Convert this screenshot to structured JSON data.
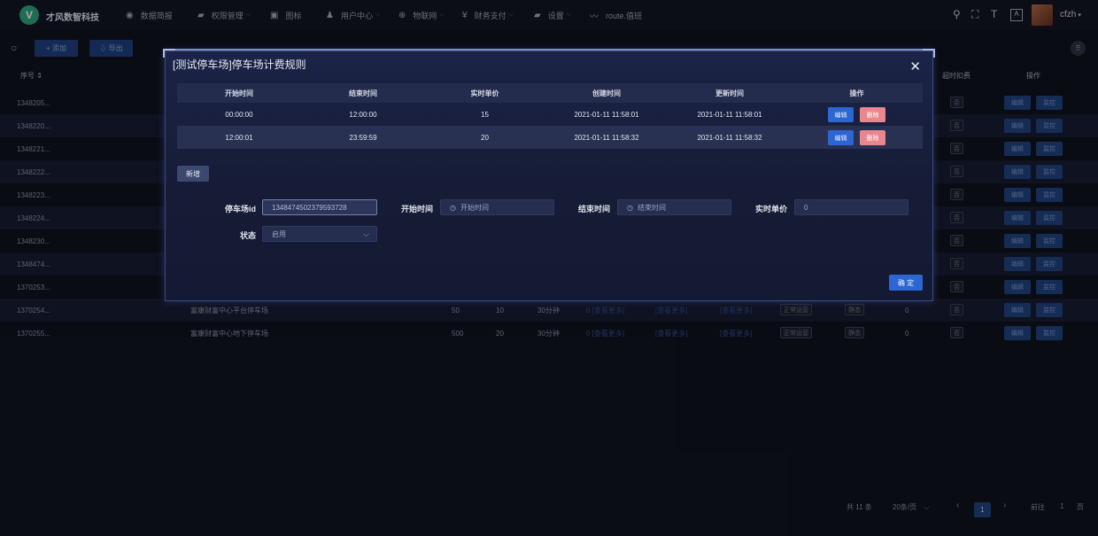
{
  "brand": {
    "logo_letter": "V",
    "name": "才风数智科技"
  },
  "nav": [
    {
      "icon": "dashboard-icon",
      "label": "数据简报",
      "dropdown": false
    },
    {
      "icon": "lock-icon",
      "label": "权限管理",
      "dropdown": true
    },
    {
      "icon": "icon-icon",
      "label": "图标",
      "dropdown": false
    },
    {
      "icon": "user-icon",
      "label": "用户中心",
      "dropdown": true
    },
    {
      "icon": "iot-icon",
      "label": "物联网",
      "dropdown": true
    },
    {
      "icon": "yen-icon",
      "label": "财务支付",
      "dropdown": true
    },
    {
      "icon": "lock-icon",
      "label": "设置",
      "dropdown": true
    },
    {
      "icon": "route-icon",
      "label": "route.值班",
      "dropdown": false
    }
  ],
  "user": {
    "name": "cfzh"
  },
  "toolbar": {
    "add_label": "+ 添加",
    "export_label": "⇩ 导出"
  },
  "bg_table": {
    "col_id": "序号 ⇕",
    "col_flag": "超时扣费",
    "col_ops": "操作",
    "ids": [
      "1348205...",
      "1348220...",
      "1348221...",
      "1348222...",
      "1348223...",
      "1348224...",
      "1348230...",
      "1348474...",
      "1370253...",
      "1370254...",
      "1370255..."
    ],
    "row10": {
      "name": "富康财富中心平台停车场",
      "v1": "50",
      "v2": "10",
      "v3": "30分钟",
      "l1": "0 [查看更多]",
      "l2": "[查看更多]",
      "l3": "[查看更多]",
      "t1": "正常运营",
      "t2": "静态",
      "v4": "0",
      "flag": "否"
    },
    "row11": {
      "name": "富康财富中心地下停车场",
      "v1": "500",
      "v2": "20",
      "v3": "30分钟",
      "l1": "0 [查看更多]",
      "l2": "[查看更多]",
      "l3": "[查看更多]",
      "t1": "正常运营",
      "t2": "静态",
      "v4": "0",
      "flag": "否"
    },
    "flag_value": "否",
    "edit_label": "编辑",
    "monitor_label": "监控"
  },
  "pagination": {
    "total": "共 11 条",
    "page_size": "20条/页",
    "current": "1",
    "goto": "前往",
    "goto_value": "1",
    "page_unit": "页"
  },
  "dialog": {
    "title": "[测试停车场]停车场计费规则",
    "columns": [
      "开始时间",
      "结束时间",
      "实时单价",
      "创建时间",
      "更新时间",
      "操作"
    ],
    "rows": [
      {
        "start": "00:00:00",
        "end": "12:00:00",
        "price": "15",
        "created": "2021-01-11 11:58:01",
        "updated": "2021-01-11 11:58:01"
      },
      {
        "start": "12:00:01",
        "end": "23:59:59",
        "price": "20",
        "created": "2021-01-11 11:58:32",
        "updated": "2021-01-11 11:58:32"
      }
    ],
    "edit_label": "编辑",
    "delete_label": "删除",
    "add_label": "新增",
    "form": {
      "lot_id_label": "停车场id",
      "lot_id_value": "1348474502379593728",
      "start_label": "开始时间",
      "start_placeholder": "开始时间",
      "end_label": "结束时间",
      "end_placeholder": "结束时间",
      "price_label": "实时单价",
      "price_value": "0",
      "status_label": "状态",
      "status_value": "启用"
    },
    "confirm_label": "确 定"
  }
}
